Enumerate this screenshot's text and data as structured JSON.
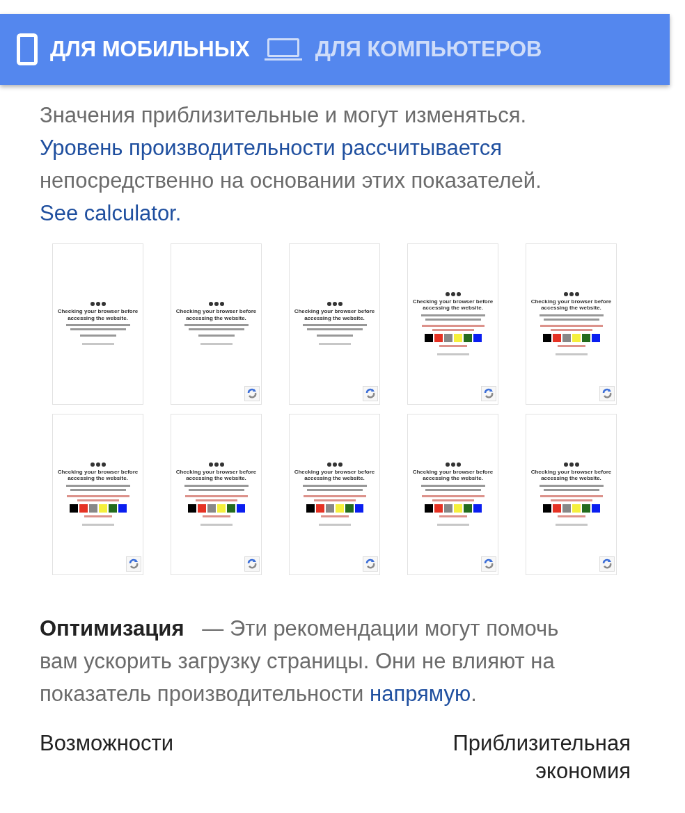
{
  "tabs": [
    {
      "label": "ДЛЯ МОБИЛЬНЫХ",
      "selected": true
    },
    {
      "label": "ДЛЯ КОМПЬЮТЕРОВ",
      "selected": false
    }
  ],
  "intro": [
    {
      "kind": "text",
      "text": "Значения приблизительные и могут изменяться. "
    },
    {
      "kind": "link",
      "text": "Уровень производительности рассчитывается"
    },
    {
      "kind": "text",
      "text": " непосредственно на основании этих показателей. "
    },
    {
      "kind": "link",
      "text": "See calculator."
    }
  ],
  "screenshots": [
    {
      "kind": "wait",
      "badge": false,
      "title": "Checking your browser before accessing the website."
    },
    {
      "kind": "wait",
      "badge": true,
      "title": "Checking your browser before accessing the website."
    },
    {
      "kind": "wait",
      "badge": true,
      "title": "Checking your browser before accessing the website."
    },
    {
      "kind": "captcha",
      "badge": true,
      "title": "Checking your browser before accessing the website.",
      "swatches": [
        {
          "color": "#000000"
        },
        {
          "color": "#e53224"
        },
        {
          "color": "#888888"
        },
        {
          "color": "#f5f03c"
        },
        {
          "color": "#246b1e"
        },
        {
          "color": "#0a1ef0"
        }
      ]
    },
    {
      "kind": "captcha",
      "badge": true,
      "title": "Checking your browser before accessing the website.",
      "swatches": [
        {
          "color": "#000000"
        },
        {
          "color": "#e53224"
        },
        {
          "color": "#888888"
        },
        {
          "color": "#f5f03c"
        },
        {
          "color": "#246b1e"
        },
        {
          "color": "#0a1ef0"
        }
      ]
    },
    {
      "kind": "captcha",
      "badge": true,
      "title": "Checking your browser before accessing the website.",
      "swatches": [
        {
          "color": "#000000"
        },
        {
          "color": "#e53224"
        },
        {
          "color": "#888888"
        },
        {
          "color": "#f5f03c"
        },
        {
          "color": "#246b1e"
        },
        {
          "color": "#0a1ef0"
        }
      ]
    },
    {
      "kind": "captcha",
      "badge": true,
      "title": "Checking your browser before accessing the website.",
      "swatches": [
        {
          "color": "#000000"
        },
        {
          "color": "#e53224"
        },
        {
          "color": "#888888"
        },
        {
          "color": "#f5f03c"
        },
        {
          "color": "#246b1e"
        },
        {
          "color": "#0a1ef0"
        }
      ]
    },
    {
      "kind": "captcha",
      "badge": true,
      "title": "Checking your browser before accessing the website.",
      "swatches": [
        {
          "color": "#000000"
        },
        {
          "color": "#e53224"
        },
        {
          "color": "#888888"
        },
        {
          "color": "#f5f03c"
        },
        {
          "color": "#246b1e"
        },
        {
          "color": "#0a1ef0"
        }
      ]
    },
    {
      "kind": "captcha",
      "badge": true,
      "title": "Checking your browser before accessing the website.",
      "swatches": [
        {
          "color": "#000000"
        },
        {
          "color": "#e53224"
        },
        {
          "color": "#888888"
        },
        {
          "color": "#f5f03c"
        },
        {
          "color": "#246b1e"
        },
        {
          "color": "#0a1ef0"
        }
      ]
    },
    {
      "kind": "captcha",
      "badge": true,
      "title": "Checking your browser before accessing the website.",
      "swatches": [
        {
          "color": "#000000"
        },
        {
          "color": "#e53224"
        },
        {
          "color": "#888888"
        },
        {
          "color": "#f5f03c"
        },
        {
          "color": "#246b1e"
        },
        {
          "color": "#0a1ef0"
        }
      ]
    }
  ],
  "optimization": [
    {
      "kind": "strong",
      "text": "Оптимизация"
    },
    {
      "kind": "text",
      "text": "   — Эти рекомендации могут помочь вам ускорить загрузку страницы. Они не влияют на показатель производительности "
    },
    {
      "kind": "link",
      "text": "напрямую"
    },
    {
      "kind": "text",
      "text": "."
    }
  ],
  "table": {
    "columns": [
      "Возможности",
      "Приблизительная экономия"
    ]
  }
}
